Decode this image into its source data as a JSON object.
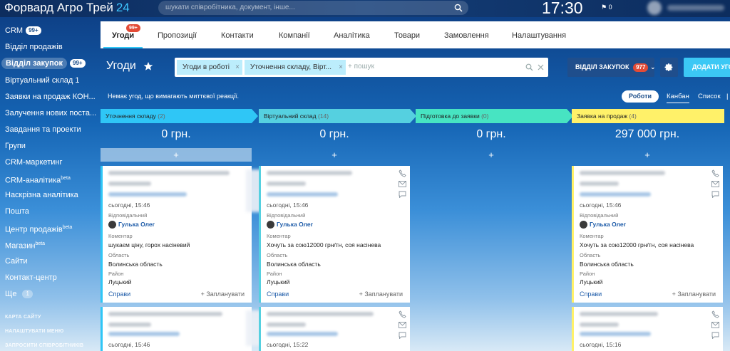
{
  "app": {
    "name": "Форвард Агро Трей",
    "suffix": "24"
  },
  "search": {
    "placeholder": "шукати співробітника, документ, інше..."
  },
  "clock": {
    "time": "17:30",
    "flag_count": "0"
  },
  "sidebar": {
    "items": [
      {
        "label": "CRM",
        "badge": "99+"
      },
      {
        "label": "Відділ продажів"
      },
      {
        "label": "Відділ закупок",
        "badge": "99+"
      },
      {
        "label": "Віртуальний склад 1"
      },
      {
        "label": "Заявки на продаж КОН..."
      },
      {
        "label": "Залучення нових поста..."
      },
      {
        "label": "Завдання та проекти"
      },
      {
        "label": "Групи"
      },
      {
        "label": "CRM-маркетинг"
      },
      {
        "label": "CRM-аналітика",
        "sup": "beta"
      },
      {
        "label": "Наскрізна аналітика"
      },
      {
        "label": "Пошта"
      },
      {
        "label": "Центр продажів",
        "sup": "beta"
      },
      {
        "label": "Магазин",
        "sup": "beta"
      },
      {
        "label": "Сайти"
      },
      {
        "label": "Контакт-центр"
      },
      {
        "label": "Ще",
        "count": "1"
      }
    ],
    "footer": [
      "КАРТА САЙТУ",
      "НАЛАШТУВАТИ МЕНЮ",
      "ЗАПРОСИТИ СПІВРОБІТНИКІВ"
    ]
  },
  "tabs": [
    {
      "label": "Угоди",
      "badge": "99+"
    },
    {
      "label": "Пропозиції"
    },
    {
      "label": "Контакти"
    },
    {
      "label": "Компанії"
    },
    {
      "label": "Аналітика"
    },
    {
      "label": "Товари"
    },
    {
      "label": "Замовлення"
    },
    {
      "label": "Налаштування"
    }
  ],
  "header": {
    "title": "Угоди",
    "filters": [
      "Угоди в роботі",
      "Уточнення складу, Вірт..."
    ],
    "search_placeholder": "+ пошук",
    "dept_label": "ВІДДІЛ ЗАКУПОК",
    "dept_count": "977",
    "add_label": "ДОДАТИ УГО"
  },
  "notice": "Немає угод, що вимагають миттєвої реакції.",
  "views": {
    "works": "Роботи",
    "kanban": "Канбан",
    "list": "Список"
  },
  "columns": [
    {
      "title": "Уточнення складу",
      "count": "(2)",
      "sum": "0 грн.",
      "color": "#2fc6f6"
    },
    {
      "title": "Віртуальний склад",
      "count": "(14)",
      "sum": "0 грн.",
      "color": "#55d0e0"
    },
    {
      "title": "Підготовка до заявки",
      "count": "(0)",
      "sum": "0 грн.",
      "color": "#47e4c2"
    },
    {
      "title": "Заявка на продаж",
      "count": "(4)",
      "sum": "297 000 грн.",
      "color": "#fff169"
    }
  ],
  "cards": [
    {
      "date": "сьогодні, 15:46",
      "resp_label": "Відповідальний",
      "person": "Гулька Олег",
      "comment_label": "Коментар",
      "comment": "шукаєм ціну, горох насіневий",
      "region_label": "Область",
      "region": "Волинська область",
      "district_label": "Район",
      "district": "Луцький",
      "actions": "Справи",
      "plan": "+ Запланувати"
    },
    {
      "date": "сьогодні, 15:46",
      "resp_label": "Відповідальний",
      "person": "Гулька Олег",
      "comment_label": "Коментар",
      "comment": "Хочуть за сою12000 грн/тн, соя насінева",
      "region_label": "Область",
      "region": "Волинська область",
      "district_label": "Район",
      "district": "Луцький",
      "actions": "Справи",
      "plan": "+ Запланувати"
    },
    {
      "date": "сьогодні, 15:46",
      "resp_label": "Відповідальний",
      "person": "Гулька Олег",
      "comment_label": "Коментар",
      "comment": "Хочуть за сою12000 грн/тн, соя насінева",
      "region_label": "Область",
      "region": "Волинська область",
      "district_label": "Район",
      "district": "Луцький",
      "actions": "Справи",
      "plan": "+ Запланувати"
    }
  ],
  "second_row_dates": [
    "сьогодні, 15:46",
    "сьогодні, 15:22",
    "сьогодні, 15:16"
  ]
}
